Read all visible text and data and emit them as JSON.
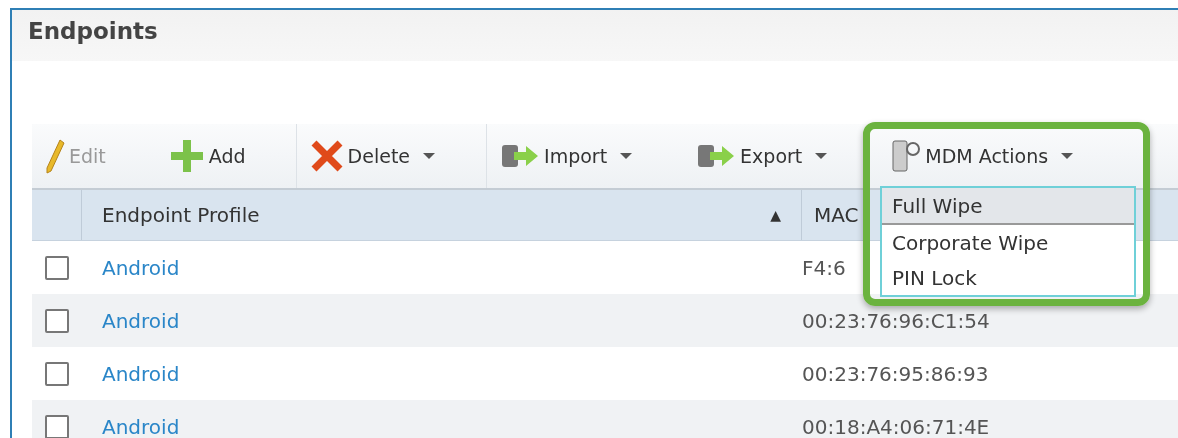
{
  "title": "Endpoints",
  "toolbar": [
    {
      "kind": "edit",
      "label": "Edit",
      "disabled": true,
      "caret": false
    },
    {
      "kind": "add",
      "label": "Add",
      "disabled": false,
      "caret": false
    },
    {
      "kind": "delete",
      "label": "Delete",
      "disabled": false,
      "caret": true
    },
    {
      "kind": "import",
      "label": "Import",
      "disabled": false,
      "caret": true
    },
    {
      "kind": "export",
      "label": "Export",
      "disabled": false,
      "caret": true
    },
    {
      "kind": "mdm",
      "label": "MDM Actions",
      "disabled": false,
      "caret": true
    }
  ],
  "table": {
    "columns": [
      {
        "label": "Endpoint Profile",
        "sort": "▲"
      },
      {
        "label": "MAC"
      }
    ],
    "rows": [
      {
        "checked": false,
        "profile": "Android",
        "mac": "F4:6"
      },
      {
        "checked": false,
        "profile": "Android",
        "mac": "00:23:76:96:C1:54"
      },
      {
        "checked": false,
        "profile": "Android",
        "mac": "00:23:76:95:86:93"
      },
      {
        "checked": false,
        "profile": "Android",
        "mac": "00:18:A4:06:71:4E"
      }
    ]
  },
  "menu": {
    "items": [
      {
        "label": "Full Wipe",
        "selected": true
      },
      {
        "label": "Corporate Wipe",
        "selected": false
      },
      {
        "label": "PIN Lock",
        "selected": false
      }
    ]
  }
}
